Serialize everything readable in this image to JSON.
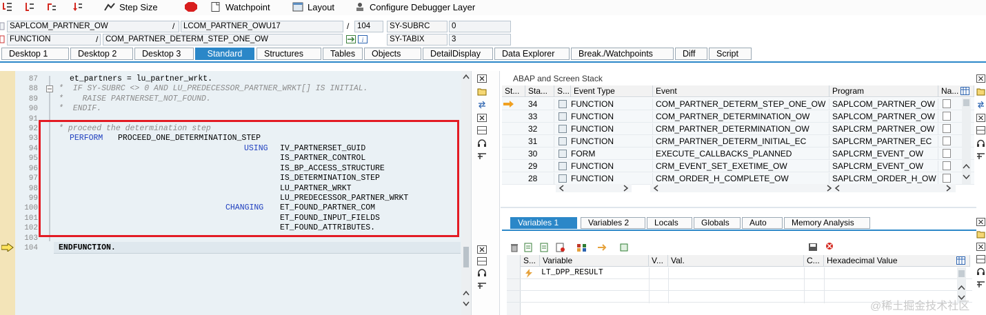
{
  "toolbar": {
    "step_size": "Step Size",
    "watchpoint": "Watchpoint",
    "layout": "Layout",
    "configure": "Configure Debugger Layer"
  },
  "info": {
    "program": "SAPLCOM_PARTNER_OW",
    "include": "LCOM_PARTNER_OWU17",
    "line": "104",
    "sysubrc_label": "SY-SUBRC",
    "sysubrc_value": "0",
    "type": "FUNCTION",
    "name": "COM_PARTNER_DETERM_STEP_ONE_OW",
    "tabix_label": "SY-TABIX",
    "tabix_value": "3",
    "sep1": "/",
    "sep2": "/",
    "sep3": "/"
  },
  "tabs": [
    "Desktop 1",
    "Desktop 2",
    "Desktop 3",
    "Standard",
    "Structures",
    "Tables",
    "Objects",
    "DetailDisplay",
    "Data Explorer",
    "Break./Watchpoints",
    "Diff",
    "Script"
  ],
  "code": {
    "lines": [
      {
        "n": "87",
        "t": "et_partners = lu_partner_wrkt."
      },
      {
        "n": "88",
        "t": "*  IF SY-SUBRC <> 0 AND LU_PREDECESSOR_PARTNER_WRKT[] IS INITIAL."
      },
      {
        "n": "89",
        "t": "*    RAISE PARTNERSET_NOT_FOUND."
      },
      {
        "n": "90",
        "t": "*  ENDIF."
      },
      {
        "n": "91",
        "t": ""
      },
      {
        "n": "92",
        "t": "* proceed the determination step"
      },
      {
        "n": "93",
        "t": "PROCEED_ONE_DETERMINATION_STEP"
      },
      {
        "n": "94",
        "t": "IV_PARTNERSET_GUID"
      },
      {
        "n": "95",
        "t": "IS_PARTNER_CONTROL"
      },
      {
        "n": "96",
        "t": "IS_BP_ACCESS_STRUCTURE"
      },
      {
        "n": "97",
        "t": "IS_DETERMINATION_STEP"
      },
      {
        "n": "98",
        "t": "LU_PARTNER_WRKT"
      },
      {
        "n": "99",
        "t": "LU_PREDECESSOR_PARTNER_WRKT"
      },
      {
        "n": "100",
        "t": "ET_FOUND_PARTNER_COM"
      },
      {
        "n": "101",
        "t": "ET_FOUND_INPUT_FIELDS"
      },
      {
        "n": "102",
        "t": "ET_FOUND_ATTRIBUTES."
      },
      {
        "n": "103",
        "t": ""
      },
      {
        "n": "104",
        "t": "ENDFUNCTION."
      }
    ],
    "kw_perform": "PERFORM",
    "kw_using": "USING",
    "kw_changing": "CHANGING"
  },
  "stack": {
    "title": "ABAP and Screen Stack",
    "headers": [
      "St...",
      "Sta...",
      "S...",
      "Event Type",
      "Event",
      "Program",
      "Na..."
    ],
    "rows": [
      {
        "level": "34",
        "type": "FUNCTION",
        "event": "COM_PARTNER_DETERM_STEP_ONE_OW",
        "program": "SAPLCOM_PARTNER_OW"
      },
      {
        "level": "33",
        "type": "FUNCTION",
        "event": "COM_PARTNER_DETERMINATION_OW",
        "program": "SAPLCOM_PARTNER_OW"
      },
      {
        "level": "32",
        "type": "FUNCTION",
        "event": "CRM_PARTNER_DETERMINATION_OW",
        "program": "SAPLCRM_PARTNER_OW"
      },
      {
        "level": "31",
        "type": "FUNCTION",
        "event": "CRM_PARTNER_DETERM_INITIAL_EC",
        "program": "SAPLCRM_PARTNER_EC"
      },
      {
        "level": "30",
        "type": "FORM",
        "event": "EXECUTE_CALLBACKS_PLANNED",
        "program": "SAPLCRM_EVENT_OW"
      },
      {
        "level": "29",
        "type": "FUNCTION",
        "event": "CRM_EVENT_SET_EXETIME_OW",
        "program": "SAPLCRM_EVENT_OW"
      },
      {
        "level": "28",
        "type": "FUNCTION",
        "event": "CRM_ORDER_H_COMPLETE_OW",
        "program": "SAPLCRM_ORDER_H_OW"
      }
    ]
  },
  "variables": {
    "tabs": [
      "Variables 1",
      "Variables 2",
      "Locals",
      "Globals",
      "Auto",
      "Memory Analysis"
    ],
    "headers": [
      "S...",
      "Variable",
      "V...",
      "Val.",
      "C...",
      "Hexadecimal Value"
    ],
    "rows": [
      {
        "variable": "LT_DPP_RESULT"
      }
    ]
  },
  "watermark": "@稀土掘金技术社区",
  "colors": {
    "accent": "#2b87c8",
    "highlight_box": "#e31b23",
    "keyword": "#1f3fbf"
  }
}
